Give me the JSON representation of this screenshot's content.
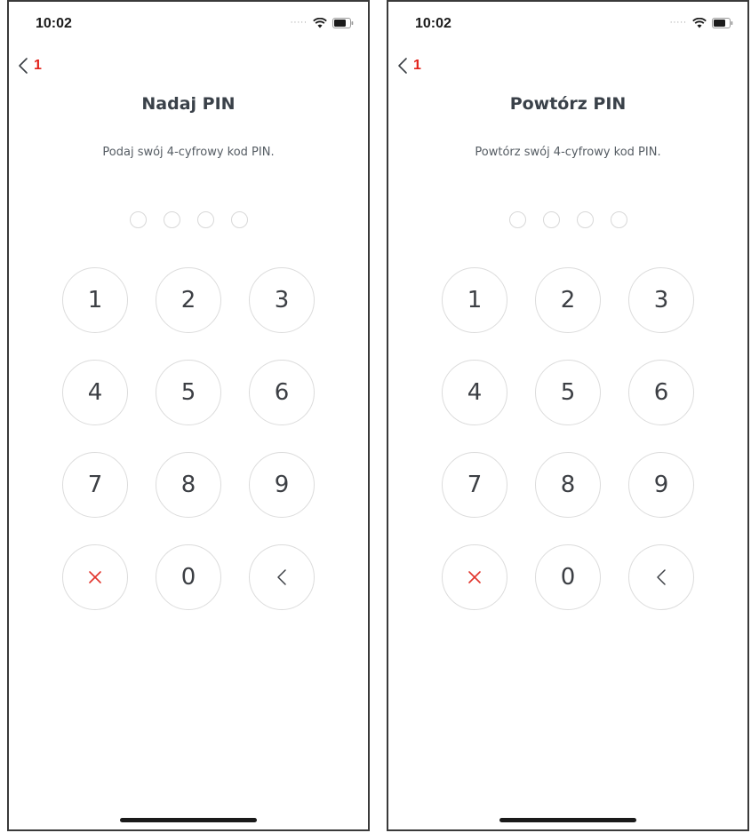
{
  "screens": [
    {
      "status_time": "10:02",
      "back_badge": "1",
      "title": "Nadaj PIN",
      "subtitle": "Podaj swój 4-cyfrowy kod PIN.",
      "keys": [
        "1",
        "2",
        "3",
        "4",
        "5",
        "6",
        "7",
        "8",
        "9",
        "×",
        "0",
        "<"
      ]
    },
    {
      "status_time": "10:02",
      "back_badge": "1",
      "title": "Powtórz PIN",
      "subtitle": "Powtórz swój 4-cyfrowy kod PIN.",
      "keys": [
        "1",
        "2",
        "3",
        "4",
        "5",
        "6",
        "7",
        "8",
        "9",
        "×",
        "0",
        "<"
      ]
    }
  ],
  "pin_length": 4,
  "icons": {
    "wifi": "wifi-icon",
    "battery": "battery-icon",
    "back": "chevron-left-icon",
    "cancel": "close-icon",
    "delete": "chevron-left-icon"
  },
  "colors": {
    "accent_red": "#e2241c",
    "text_dark": "#3a4149",
    "circle_border": "#dcdcdc"
  }
}
